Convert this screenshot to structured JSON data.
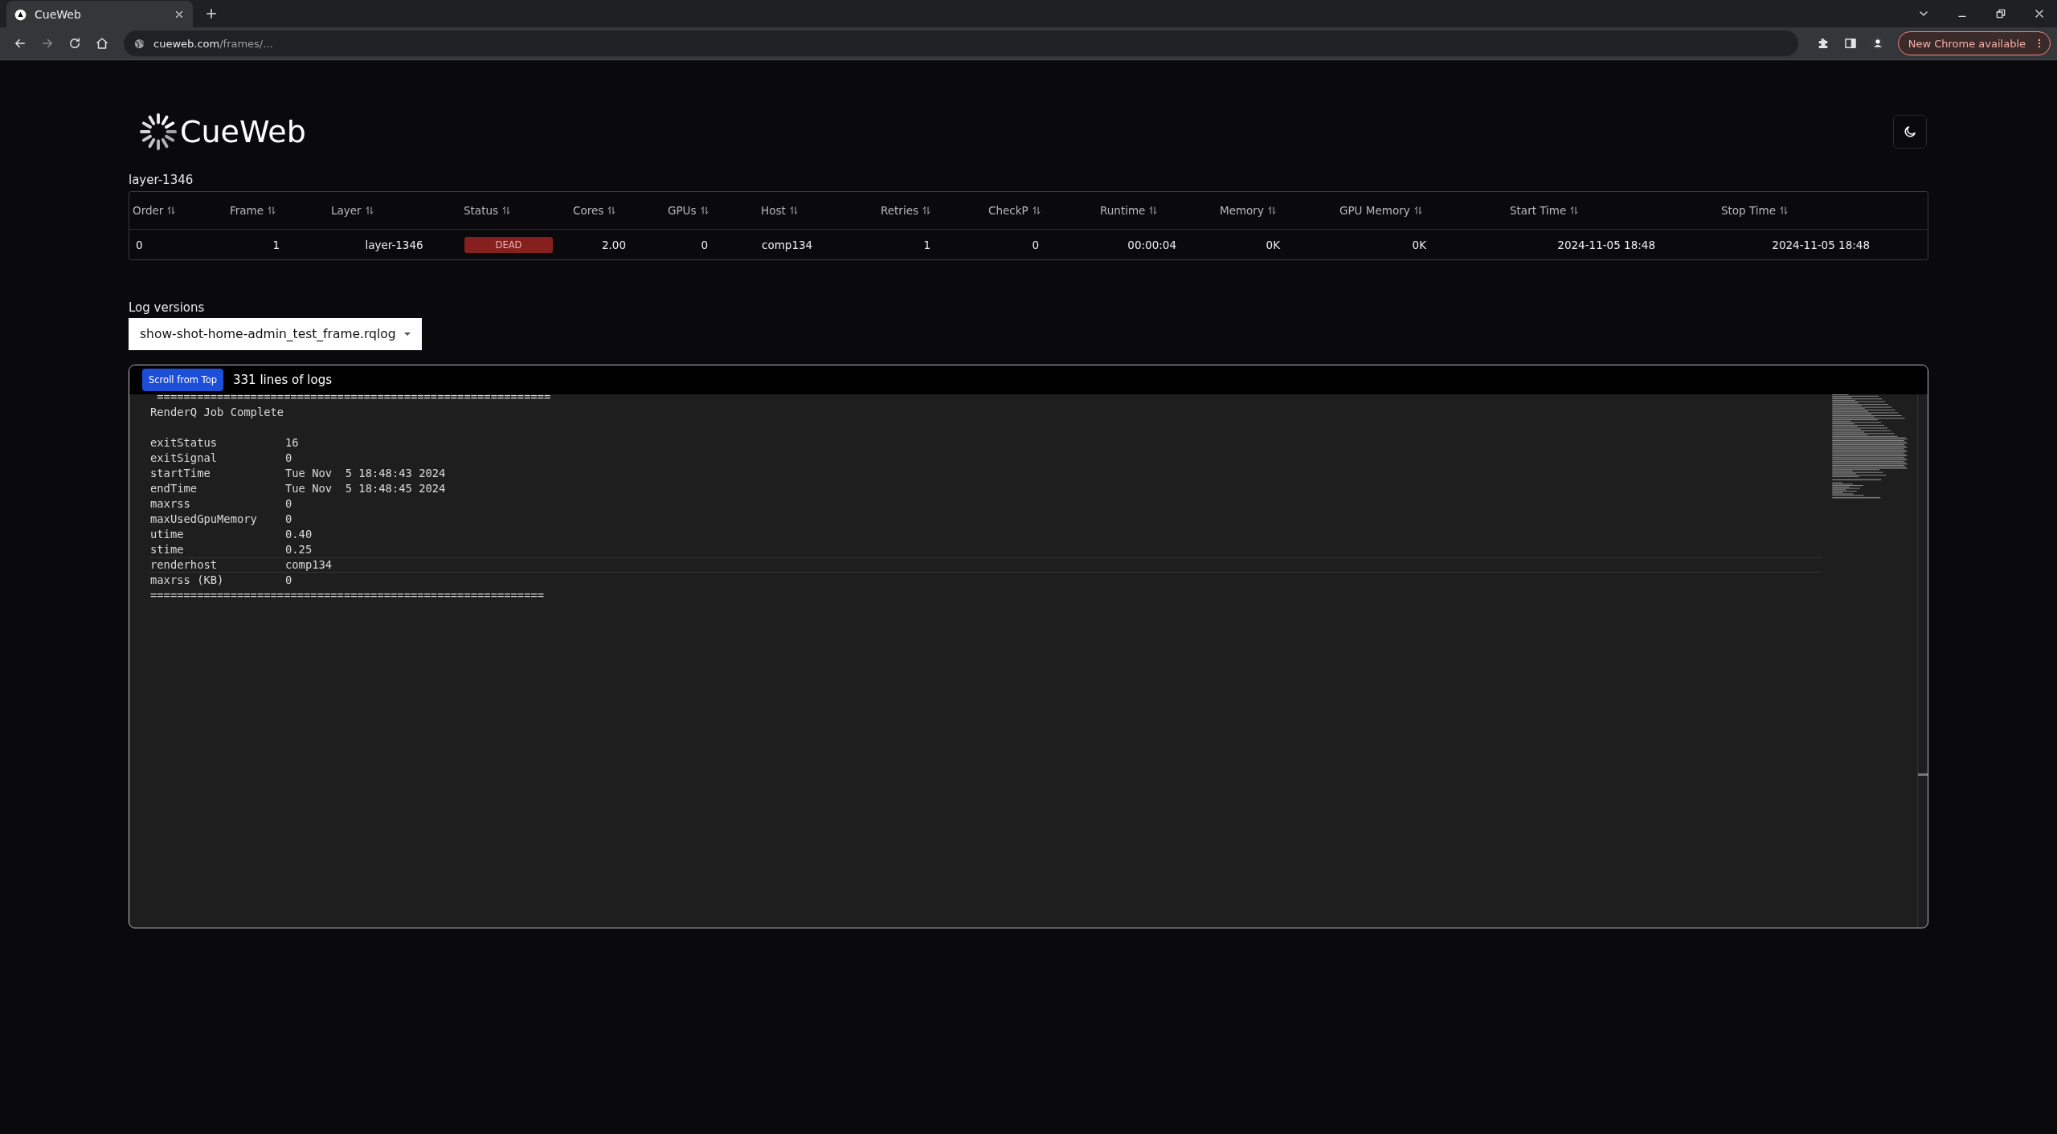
{
  "browser": {
    "tab": {
      "title": "CueWeb"
    },
    "url": {
      "host": "cueweb.com",
      "path": "/frames/..."
    },
    "update_button": "New Chrome available"
  },
  "header": {
    "logo": "CueWeb"
  },
  "frame_table": {
    "title": "layer-1346",
    "columns": [
      "Order",
      "Frame",
      "Layer",
      "Status",
      "Cores",
      "GPUs",
      "Host",
      "Retries",
      "CheckP",
      "Runtime",
      "Memory",
      "GPU Memory",
      "Start Time",
      "Stop Time"
    ],
    "rows": [
      {
        "cells": [
          "0",
          "1",
          "layer-1346",
          {
            "kind": "status",
            "text": "DEAD",
            "color": "#86201f"
          },
          "2.00",
          "0",
          "comp134",
          "1",
          "0",
          "00:00:04",
          "0K",
          "0K",
          "2024-11-05 18:48",
          "2024-11-05 18:48"
        ]
      }
    ]
  },
  "log": {
    "versions_label": "Log versions",
    "selected_version": "show-shot-home-admin_test_frame.rqlog",
    "scroll_button": "Scroll from Top",
    "line_count": "331 lines of logs",
    "lines": [
      {
        "kind": "text",
        "text": " ==========================================================="
      },
      {
        "kind": "text",
        "text": "RenderQ Job Complete"
      },
      {
        "kind": "blank"
      },
      {
        "kind": "field",
        "key": "exitStatus",
        "value": "16"
      },
      {
        "kind": "field",
        "key": "exitSignal",
        "value": "0"
      },
      {
        "kind": "field",
        "key": "startTime",
        "value": "Tue Nov  5 18:48:43 2024"
      },
      {
        "kind": "field",
        "key": "endTime",
        "value": "Tue Nov  5 18:48:45 2024"
      },
      {
        "kind": "field",
        "key": "maxrss",
        "value": "0"
      },
      {
        "kind": "field",
        "key": "maxUsedGpuMemory",
        "value": "0"
      },
      {
        "kind": "field",
        "key": "utime",
        "value": "0.40"
      },
      {
        "kind": "field",
        "key": "stime",
        "value": "0.25"
      },
      {
        "kind": "field",
        "key": "renderhost",
        "value": "comp134",
        "highlighted": true
      },
      {
        "kind": "field",
        "key": "maxrss (KB)",
        "value": "0"
      },
      {
        "kind": "text",
        "text": "==========================================================="
      }
    ]
  }
}
